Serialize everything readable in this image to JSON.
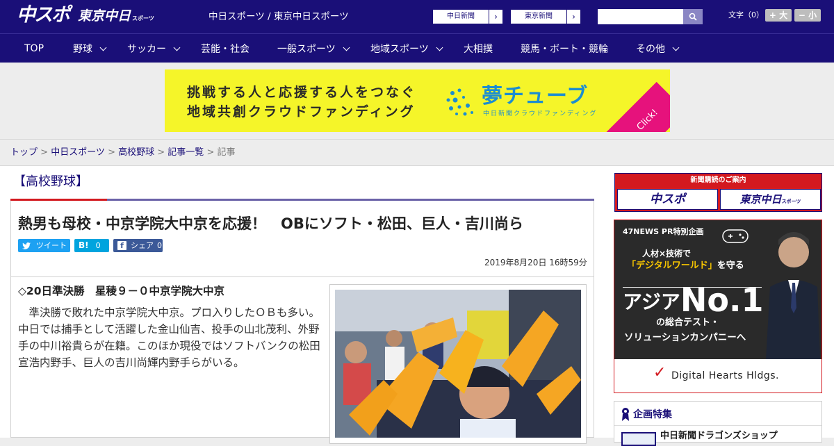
{
  "header": {
    "logo_chuspo": "中スポ",
    "logo_tokyo": "東京中日",
    "logo_tokyo_small": "スポーツ",
    "site_title": "中日スポーツ / 東京中日スポーツ",
    "newspaper_links": [
      "中日新聞",
      "東京新聞"
    ],
    "search_placeholder": "",
    "font_size_label": "文字（0）",
    "font_larger": "+ 大",
    "font_smaller": "− 小"
  },
  "nav": {
    "items": [
      {
        "label": "TOP"
      },
      {
        "label": "野球"
      },
      {
        "label": "サッカー"
      },
      {
        "label": "芸能・社会"
      },
      {
        "label": "一般スポーツ"
      },
      {
        "label": "地域スポーツ"
      },
      {
        "label": "大相撲"
      },
      {
        "label": "競馬・ボート・競輪"
      },
      {
        "label": "その他"
      }
    ]
  },
  "ad": {
    "line1": "挑戦する人と応援する人をつなぐ",
    "line2": "地域共創クラウドファンディング",
    "brand": "夢チューブ",
    "sub": "中日新聞クラウドファンディング",
    "click": "Click!"
  },
  "breadcrumb": {
    "items": [
      "トップ",
      "中日スポーツ",
      "高校野球",
      "記事一覧"
    ],
    "separator": " > ",
    "current": "記事"
  },
  "article": {
    "category": "【高校野球】",
    "headline": "熱男も母校・中京学院大中京を応援！　OBにソフト・松田、巨人・吉川尚ら",
    "share": {
      "tweet": "ツイート",
      "hatena_count": "0",
      "fb_label": "シェア",
      "fb_count": "0"
    },
    "date": "2019年8月20日 16時59分",
    "subhead": "◇20日準決勝　星稜９－０中京学院大中京",
    "body": "準決勝で敗れた中京学院大中京。プロ入りしたＯＢも多い。中日では捕手として活躍した金山仙吉、投手の山北茂利、外野手の中川裕貴らが在籍。このほか現役ではソフトバンクの松田宣浩内野手、巨人の吉川尚輝内野手らがいる。"
  },
  "sidebar": {
    "subscribe_title": "新聞購読のご案内",
    "subscribe_logo_chuspo": "中スポ",
    "subscribe_logo_tokyo": "東京中日",
    "subscribe_logo_tokyo_small": "スポーツ",
    "pr": {
      "tag": "47NEWS PR特別企画",
      "line1": "人材×技術で",
      "line2_a": "「デジタルワールド」",
      "line2_b": "を守る",
      "big_a": "アジア",
      "big_b": "No.1",
      "line3": "の総合テスト・",
      "line4": "ソリューションカンパニーへ",
      "company": "Digital Hearts Hldgs."
    },
    "tokushu_title": "企画特集",
    "tokushu_item": "中日新聞ドラゴンズショップ"
  },
  "colors": {
    "brand_navy": "#1a0f78",
    "accent_red": "#d3191f",
    "twitter": "#1da1f2",
    "hatena": "#00a4de",
    "facebook": "#3b5998"
  }
}
